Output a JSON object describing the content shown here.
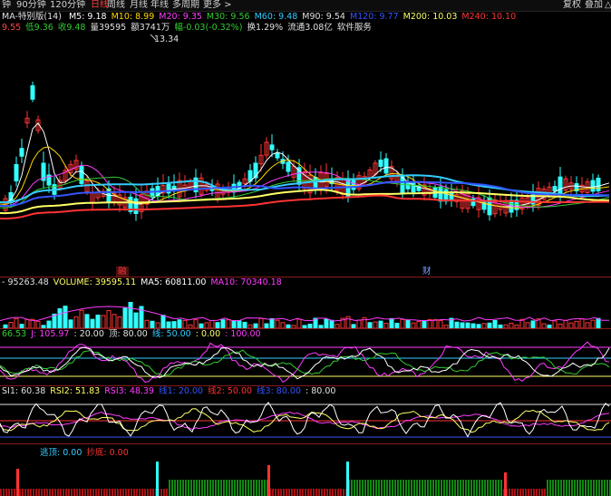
{
  "toolbar": {
    "left_items": [
      "钟",
      "90分钟",
      "120分钟",
      "日线",
      "周线",
      "月线",
      "年线",
      "多周期",
      "更多 >"
    ],
    "active_index": 3,
    "right_items": [
      "复权",
      "叠加",
      "△"
    ]
  },
  "main_chart": {
    "ma_label": "MA-特别版(14)",
    "ma_items": [
      {
        "label": "M5: 9.18",
        "color": "#ffffff"
      },
      {
        "label": "M10: 8.99",
        "color": "#ffd700"
      },
      {
        "label": "M20: 9.35",
        "color": "#ff3cff"
      },
      {
        "label": "M30: 9.56",
        "color": "#33cc33"
      },
      {
        "label": "M60: 9.48",
        "color": "#33ccff"
      },
      {
        "label": "M90: 9.54",
        "color": "#e0e0e0"
      },
      {
        "label": "M120: 9.77",
        "color": "#3355ff"
      },
      {
        "label": "M200: 10.03",
        "color": "#ffff66"
      },
      {
        "label": "M240: 10.10",
        "color": "#ff3333"
      }
    ],
    "info_items": [
      {
        "label": "9.55",
        "color": "#ff4444"
      },
      {
        "label": "低9.36",
        "color": "#33cc33"
      },
      {
        "label": "收9.48",
        "color": "#33cc33"
      },
      {
        "label": "量39595",
        "color": "#e0e0e0"
      },
      {
        "label": "额3741万",
        "color": "#e0e0e0"
      },
      {
        "label": "幅-0.03(-0.32%)",
        "color": "#33cc33"
      },
      {
        "label": "换1.29%",
        "color": "#e0e0e0"
      },
      {
        "label": "流通3.08亿",
        "color": "#e0e0e0"
      },
      {
        "label": "软件服务",
        "color": "#e0e0e0"
      }
    ],
    "peak_label": "13.34",
    "markers": [
      "融",
      "财"
    ]
  },
  "volume_panel": {
    "items": [
      {
        "label": "- 95263.48",
        "color": "#e0e0e0"
      },
      {
        "label": "VOLUME: 39595.11",
        "color": "#ffff66"
      },
      {
        "label": "MA5: 60811.00",
        "color": "#ffffff"
      },
      {
        "label": "MA10: 70340.18",
        "color": "#ff3cff"
      }
    ]
  },
  "kdj_panel": {
    "items": [
      {
        "label": "66.53",
        "color": "#33cc33"
      },
      {
        "label": "J: 105.97",
        "color": "#ff3cff"
      },
      {
        "label": ": 20.00",
        "color": "#e0e0e0"
      },
      {
        "label": "顶: 80.00",
        "color": "#e0e0e0"
      },
      {
        "label": "线: 50.00",
        "color": "#33ccff"
      },
      {
        "label": ": 0.00",
        "color": "#ffff66"
      },
      {
        "label": ": 100.00",
        "color": "#ff3cff"
      }
    ]
  },
  "rsi_panel": {
    "items": [
      {
        "label": "SI1: 60.38",
        "color": "#e0e0e0"
      },
      {
        "label": "RSI2: 51.83",
        "color": "#ffff66"
      },
      {
        "label": "RSI3: 48.39",
        "color": "#ff3cff"
      },
      {
        "label": "线1: 20.00",
        "color": "#3355ff"
      },
      {
        "label": "线2: 50.00",
        "color": "#ff3333"
      },
      {
        "label": "线3: 80.00",
        "color": "#3355ff"
      },
      {
        "label": ": 80.00",
        "color": "#e0e0e0"
      }
    ]
  },
  "escape_panel": {
    "items": [
      {
        "label": "逃顶: 0.00",
        "color": "#33ccff"
      },
      {
        "label": "抄底: 0.00",
        "color": "#ff3333"
      }
    ]
  },
  "colors": {
    "up": "#ff3333",
    "down": "#33ffff",
    "background": "#000000",
    "separator": "#8b1a1a"
  }
}
